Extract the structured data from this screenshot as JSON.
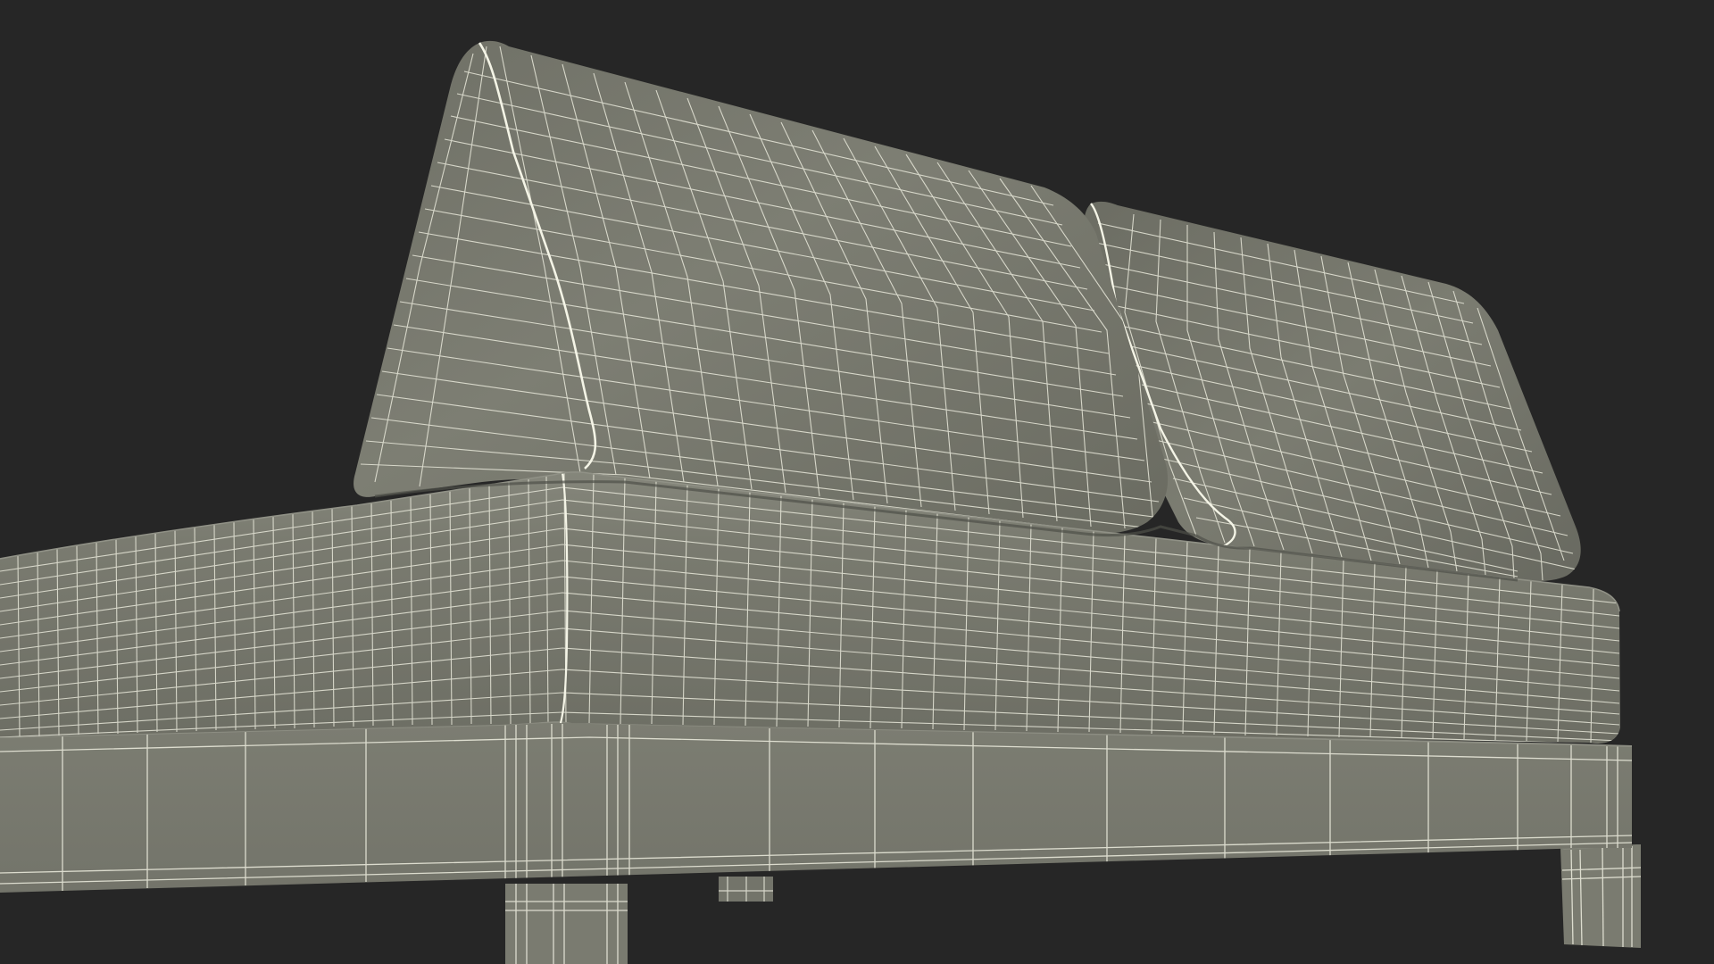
{
  "scene": {
    "background_color": "#262626",
    "mesh_fill_color": "#7a7b70",
    "mesh_shadow_color": "#5c5d54",
    "mesh_highlight_color": "#8c8d82",
    "wire_color": "#e8e8da",
    "seam_color": "#f4f4e6",
    "objects": [
      "sofa-daybed",
      "back-cushion-left",
      "back-cushion-right",
      "seat-cushion",
      "wood-frame",
      "leg-front",
      "leg-right",
      "leg-back"
    ]
  }
}
